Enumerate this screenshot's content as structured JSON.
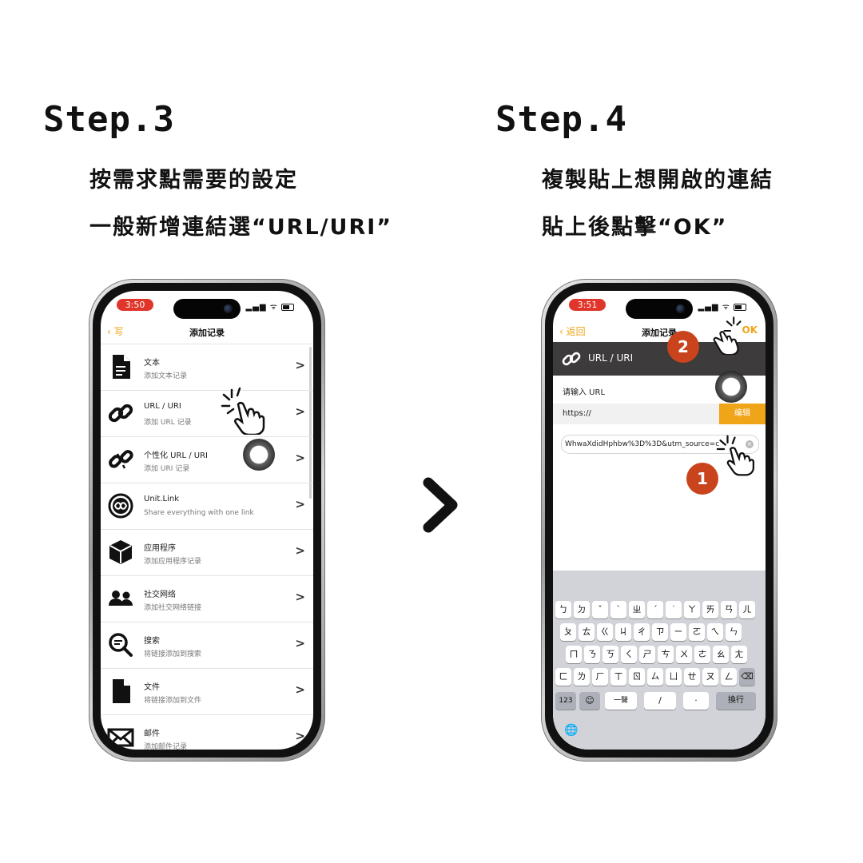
{
  "left_panel": {
    "step_label": "Step.3",
    "line1": "按需求點需要的設定",
    "line2": "一般新增連結選“URL/URI”",
    "phone": {
      "time": "3:50",
      "nav_back": "写",
      "nav_title": "添加记录",
      "rows": [
        {
          "title": "文本",
          "subtitle": "添加文本记录",
          "icon": "document-icon"
        },
        {
          "title": "URL / URI",
          "subtitle": "添加 URL 记录",
          "icon": "link-icon"
        },
        {
          "title": "个性化 URL / URI",
          "subtitle": "添加 URI 记录",
          "icon": "broken-link-icon"
        },
        {
          "title": "Unit.Link",
          "subtitle": "Share everything with one link",
          "icon": "infinity-icon"
        },
        {
          "title": "应用程序",
          "subtitle": "添加应用程序记录",
          "icon": "cube-icon"
        },
        {
          "title": "社交网络",
          "subtitle": "添加社交网络链接",
          "icon": "people-icon"
        },
        {
          "title": "搜索",
          "subtitle": "将链接添加到搜索",
          "icon": "search-icon"
        },
        {
          "title": "文件",
          "subtitle": "将链接添加到文件",
          "icon": "file-icon"
        },
        {
          "title": "邮件",
          "subtitle": "添加邮件记录",
          "icon": "mail-icon"
        }
      ],
      "chevron": ">"
    }
  },
  "right_panel": {
    "step_label": "Step.4",
    "line1": "複製貼上想開啟的連結",
    "line2": "貼上後點擊“OK”",
    "phone": {
      "time": "3:51",
      "nav_back": "返回",
      "nav_title": "添加记录",
      "nav_ok": "OK",
      "header_title": "URL / URI",
      "input_label": "请输入 URL",
      "url_prefix": "https://",
      "edit_button": "编辑",
      "url_value": "WhwaXdidHphbw%3D%3D&utm_source=c",
      "step_badges": [
        "1",
        "2"
      ],
      "keyboard": {
        "row1": [
          "ㄅ",
          "ㄉ",
          "ˇ",
          "ˋ",
          "ㄓ",
          "ˊ",
          "˙",
          "ㄚ",
          "ㄞ",
          "ㄢ",
          "ㄦ"
        ],
        "row2": [
          "ㄆ",
          "ㄊ",
          "ㄍ",
          "ㄐ",
          "ㄔ",
          "ㄗ",
          "ㄧ",
          "ㄛ",
          "ㄟ",
          "ㄣ"
        ],
        "row3": [
          "ㄇ",
          "ㄋ",
          "ㄎ",
          "ㄑ",
          "ㄕ",
          "ㄘ",
          "ㄨ",
          "ㄜ",
          "ㄠ",
          "ㄤ"
        ],
        "row4": [
          "ㄈ",
          "ㄌ",
          "ㄏ",
          "ㄒ",
          "ㄖ",
          "ㄙ",
          "ㄩ",
          "ㄝ",
          "ㄡ",
          "ㄥ"
        ],
        "delete_key": "⌫",
        "num_key": "123",
        "emoji_key": "☺",
        "tone_key": "一聲",
        "slash_key": "/",
        "dot_key": "·",
        "return_key": "換行",
        "globe_key": "🌐"
      }
    }
  },
  "colors": {
    "accent": "#f0a418",
    "badge": "#c9441c",
    "header_dark": "#3d3b3b",
    "time_pill": "#e0352b"
  }
}
